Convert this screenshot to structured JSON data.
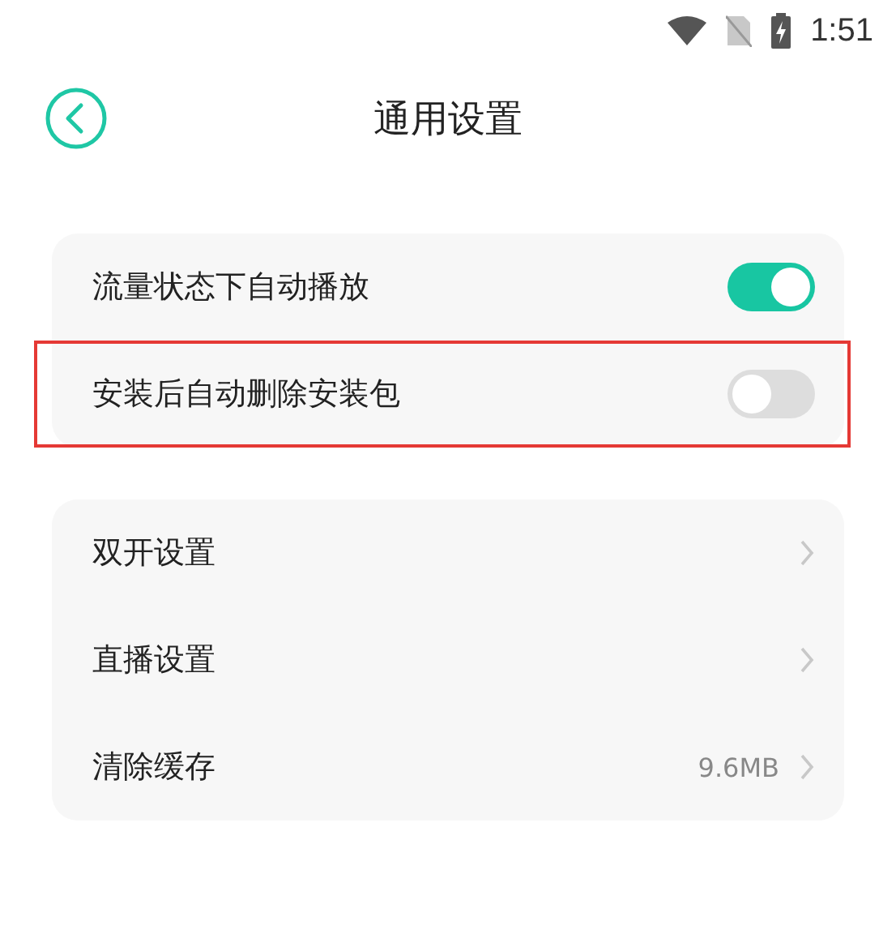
{
  "status_bar": {
    "time": "1:51"
  },
  "header": {
    "title": "通用设置"
  },
  "groups": [
    {
      "items": [
        {
          "kind": "toggle",
          "label": "流量状态下自动播放",
          "on": true,
          "highlighted": false
        },
        {
          "kind": "toggle",
          "label": "安装后自动删除安装包",
          "on": false,
          "highlighted": true
        }
      ]
    },
    {
      "items": [
        {
          "kind": "link",
          "label": "双开设置"
        },
        {
          "kind": "link",
          "label": "直播设置"
        },
        {
          "kind": "link",
          "label": "清除缓存",
          "value": "9.6MB"
        }
      ]
    }
  ]
}
